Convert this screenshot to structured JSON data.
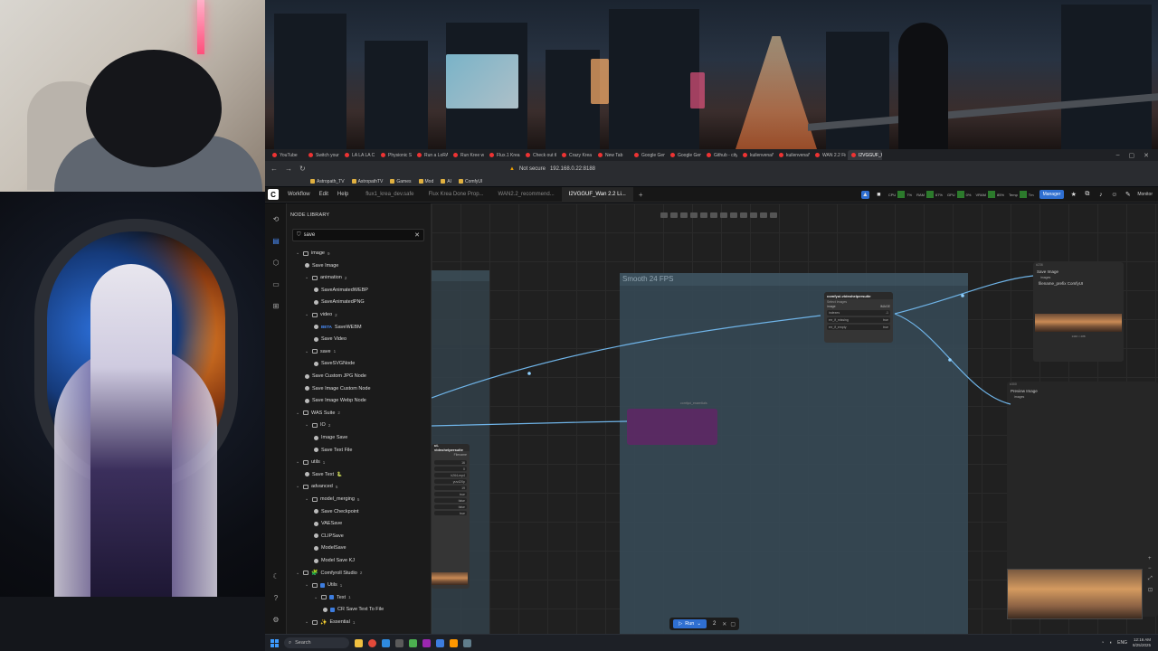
{
  "browser": {
    "tabs": [
      "YouTube",
      "Switch your drea",
      "LA LA LA C",
      "Physionic Studi",
      "Run a LoRA in",
      "Run Kree worklf",
      "Flux.1 Krea Dev",
      "Check out the k",
      "Crazy Krea Flux",
      "New Tab",
      "Google Gemini",
      "Google Gemini",
      "Github - citydu",
      "kuilenvena/Wan",
      "kuilenvena/Wan",
      "WAN 2.2 First",
      "I2VGGUF_Wan"
    ],
    "address_warning": "Not secure",
    "address": "192.168.0.22:8188",
    "bookmarks": [
      "Astropath_TV",
      "AstropathTV",
      "Games",
      "Mod",
      "AI",
      "ComfyUI"
    ]
  },
  "comfy": {
    "menu": [
      "Workflow",
      "Edit",
      "Help"
    ],
    "workflow_tabs": [
      "flux1_krea_dev.safe",
      "Flux Krea Done Prop...",
      "WAN2.2_recommend...",
      "I2VGGUF_Wan 2.2 Li..."
    ],
    "active_tab_index": 3,
    "plus": "+",
    "meters": [
      {
        "label": "CPU",
        "value": "7%"
      },
      {
        "label": "RAM",
        "value": "67%"
      },
      {
        "label": "GPU",
        "value": "0%"
      },
      {
        "label": "VRAM",
        "value": "85%"
      },
      {
        "label": "Temp",
        "value": "Tm"
      }
    ],
    "manager_label": "Manager",
    "monitor_label": "Monitor"
  },
  "library": {
    "title": "NODE LIBRARY",
    "search_value": "save",
    "tree": [
      {
        "label": "image",
        "count": "9",
        "kind": "folder",
        "depth": 0
      },
      {
        "label": "Save Image",
        "kind": "node",
        "depth": 1
      },
      {
        "label": "animation",
        "count": "2",
        "kind": "folder",
        "depth": 1
      },
      {
        "label": "SaveAnimatedWEBP",
        "kind": "node",
        "depth": 2
      },
      {
        "label": "SaveAnimatedPNG",
        "kind": "node",
        "depth": 2
      },
      {
        "label": "video",
        "count": "2",
        "kind": "folder",
        "depth": 1
      },
      {
        "label": "SaveWEBM",
        "kind": "node",
        "depth": 2,
        "badge": "BETA"
      },
      {
        "label": "Save Video",
        "kind": "node",
        "depth": 2
      },
      {
        "label": "save",
        "count": "1",
        "kind": "folder",
        "depth": 1
      },
      {
        "label": "SaveSVGNode",
        "kind": "node",
        "depth": 2
      },
      {
        "label": "Save Custom JPG Node",
        "kind": "node",
        "depth": 1
      },
      {
        "label": "Save Image Custom Node",
        "kind": "node",
        "depth": 1
      },
      {
        "label": "Save Image Webp Node",
        "kind": "node",
        "depth": 1
      },
      {
        "label": "WAS Suite",
        "count": "2",
        "kind": "folder",
        "depth": 0
      },
      {
        "label": "IO",
        "count": "2",
        "kind": "folder",
        "depth": 1
      },
      {
        "label": "Image Save",
        "kind": "node",
        "depth": 2
      },
      {
        "label": "Save Text File",
        "kind": "node",
        "depth": 2
      },
      {
        "label": "utils",
        "count": "1",
        "kind": "folder",
        "depth": 0
      },
      {
        "label": "Save Text",
        "kind": "node",
        "depth": 1,
        "tag": "🐍"
      },
      {
        "label": "advanced",
        "count": "5",
        "kind": "folder",
        "depth": 0
      },
      {
        "label": "model_merging",
        "count": "5",
        "kind": "folder",
        "depth": 1
      },
      {
        "label": "Save Checkpoint",
        "kind": "node",
        "depth": 2
      },
      {
        "label": "VAESave",
        "kind": "node",
        "depth": 2
      },
      {
        "label": "CLIPSave",
        "kind": "node",
        "depth": 2
      },
      {
        "label": "ModelSave",
        "kind": "node",
        "depth": 2
      },
      {
        "label": "Model Save KJ",
        "kind": "node",
        "depth": 2
      },
      {
        "label": "Comfyroll Studio",
        "count": "2",
        "kind": "folder",
        "depth": 0,
        "emoji": "🧩"
      },
      {
        "label": "Utils",
        "count": "1",
        "kind": "folder",
        "depth": 1,
        "sq": true
      },
      {
        "label": "Text",
        "count": "1",
        "kind": "folder",
        "depth": 2,
        "sq": true
      },
      {
        "label": "CR Save Text To File",
        "kind": "node",
        "depth": 3,
        "sq": true
      },
      {
        "label": "Essential",
        "count": "1",
        "kind": "folder",
        "depth": 1,
        "emoji": "✨"
      }
    ]
  },
  "canvas": {
    "group_title": "Smooth 24 FPS",
    "vhs_node": {
      "title": "comfyui-videohelpersuite",
      "subtitle": "Select Images",
      "port_in": "image",
      "port_out": "IMAGE",
      "widgets": [
        {
          "name": "indexes",
          "value": "-1"
        },
        {
          "name": "err_if_missing",
          "value": "true"
        },
        {
          "name": "err_if_empty",
          "value": "true"
        }
      ]
    },
    "left_node": {
      "title": "ui-videohelpersuite",
      "filename_label": "Filename",
      "values": [
        "16",
        "0",
        "h264-mp4",
        "yuv420p",
        "19",
        "true",
        "false",
        "false",
        "true"
      ]
    },
    "muted_node_title": "comfyui_essentials",
    "save_image_node": {
      "title": "Save Image",
      "port": "images",
      "widget_name": "filename_prefix",
      "widget_value": "ComfyUI",
      "caption": "1440 × 288",
      "badge": "#236"
    },
    "preview_node": {
      "title": "Preview Image",
      "port": "images",
      "badge": "#300"
    },
    "run": {
      "label": "Run",
      "queue": "2"
    }
  },
  "taskbar": {
    "search_placeholder": "Search",
    "lang": "ENG",
    "time": "12:16 AM",
    "date": "8/25/2025"
  }
}
